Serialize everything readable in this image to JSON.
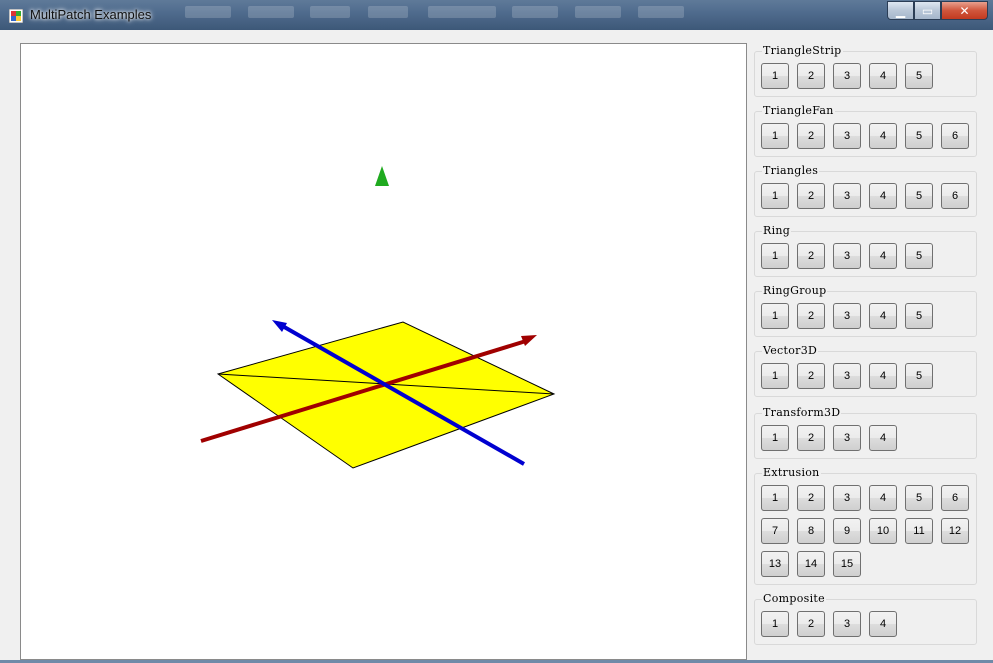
{
  "window": {
    "title": "MultiPatch Examples"
  },
  "groups": [
    {
      "label": "TriangleStrip",
      "buttons": [
        "1",
        "2",
        "3",
        "4",
        "5"
      ]
    },
    {
      "label": "TriangleFan",
      "buttons": [
        "1",
        "2",
        "3",
        "4",
        "5",
        "6"
      ]
    },
    {
      "label": "Triangles",
      "buttons": [
        "1",
        "2",
        "3",
        "4",
        "5",
        "6"
      ]
    },
    {
      "label": "Ring",
      "buttons": [
        "1",
        "2",
        "3",
        "4",
        "5"
      ]
    },
    {
      "label": "RingGroup",
      "buttons": [
        "1",
        "2",
        "3",
        "4",
        "5"
      ]
    },
    {
      "label": "Vector3D",
      "buttons": [
        "1",
        "2",
        "3",
        "4",
        "5"
      ]
    },
    {
      "label": "Transform3D",
      "buttons": [
        "1",
        "2",
        "3",
        "4"
      ]
    },
    {
      "label": "Extrusion",
      "buttons": [
        "1",
        "2",
        "3",
        "4",
        "5",
        "6",
        "7",
        "8",
        "9",
        "10",
        "11",
        "12",
        "13",
        "14",
        "15"
      ]
    },
    {
      "label": "Composite",
      "buttons": [
        "1",
        "2",
        "3",
        "4"
      ]
    }
  ],
  "scene": {
    "plane_color": "#ffff00",
    "x_axis_color": "#a00000",
    "y_axis_color": "#00a000",
    "z_axis_color": "#0000d0"
  }
}
